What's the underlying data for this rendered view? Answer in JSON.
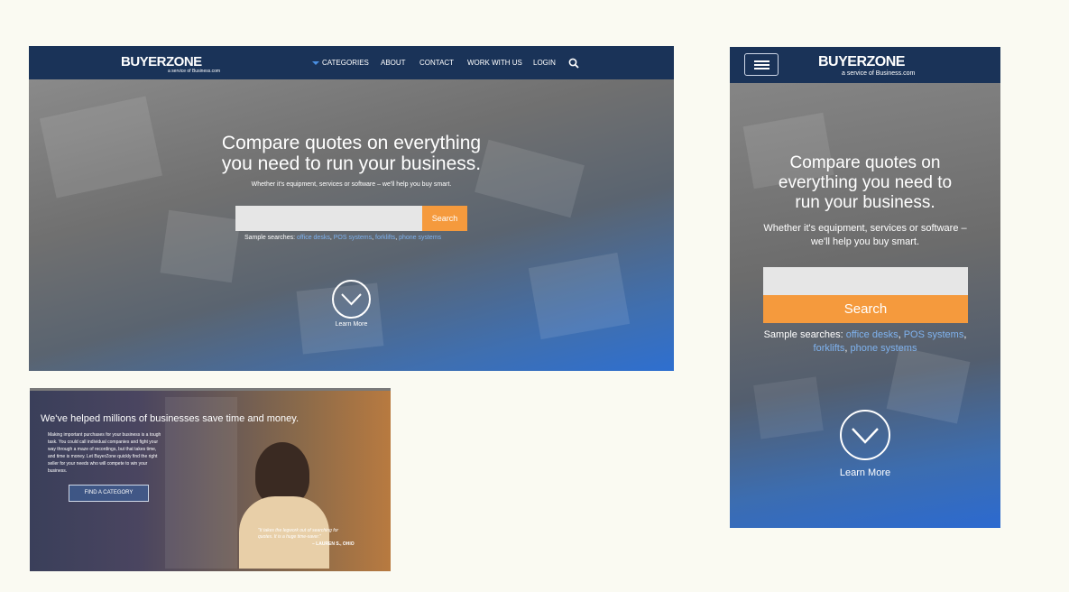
{
  "brand": {
    "logo": "BUYERZONE",
    "tagline": "a service of Business.com"
  },
  "desktop": {
    "nav": {
      "categories": "CATEGORIES",
      "about": "ABOUT",
      "contact": "CONTACT",
      "work_with_us": "WORK WITH US",
      "login": "LOGIN"
    },
    "headline_line1": "Compare quotes on everything",
    "headline_line2": "you need to run your business.",
    "subhead": "Whether it's equipment, services or software – we'll help you buy smart.",
    "search": {
      "placeholder": "",
      "button": "Search"
    },
    "samples": {
      "label": "Sample searches:",
      "items": [
        "office desks",
        "POS systems",
        "forklifts",
        "phone systems"
      ]
    },
    "learn_more": "Learn More"
  },
  "promo": {
    "headline": "We've helped millions of businesses save time and money.",
    "body_lines": [
      "Making important purchases for your business is a tough",
      "task. You could call individual companies and fight your",
      "way through a maze of recordings, but that takes time,",
      "and time is money. Let BuyerZone quickly find the right",
      "seller for your needs who will compete to win your",
      "business."
    ],
    "cta": "FIND A CATEGORY",
    "quote_line1": "\"It takes the legwork out of searching for",
    "quote_line2": "quotes. It is a huge time-saver.\"",
    "quote_author": "– LAUREN S., OHIO"
  },
  "mobile": {
    "headline_lines": [
      "Compare quotes on",
      "everything you need to",
      "run your business."
    ],
    "subhead_lines": [
      "Whether it's equipment, services or software –",
      "we'll help you buy smart."
    ],
    "search": {
      "placeholder": "",
      "button": "Search"
    },
    "samples": {
      "label": "Sample searches:",
      "items": [
        "office desks",
        "POS systems",
        "forklifts",
        "phone systems"
      ]
    },
    "learn_more": "Learn More"
  },
  "colors": {
    "nav": "#1a3358",
    "accent": "#f59a3d",
    "link": "#7fb3f0"
  }
}
